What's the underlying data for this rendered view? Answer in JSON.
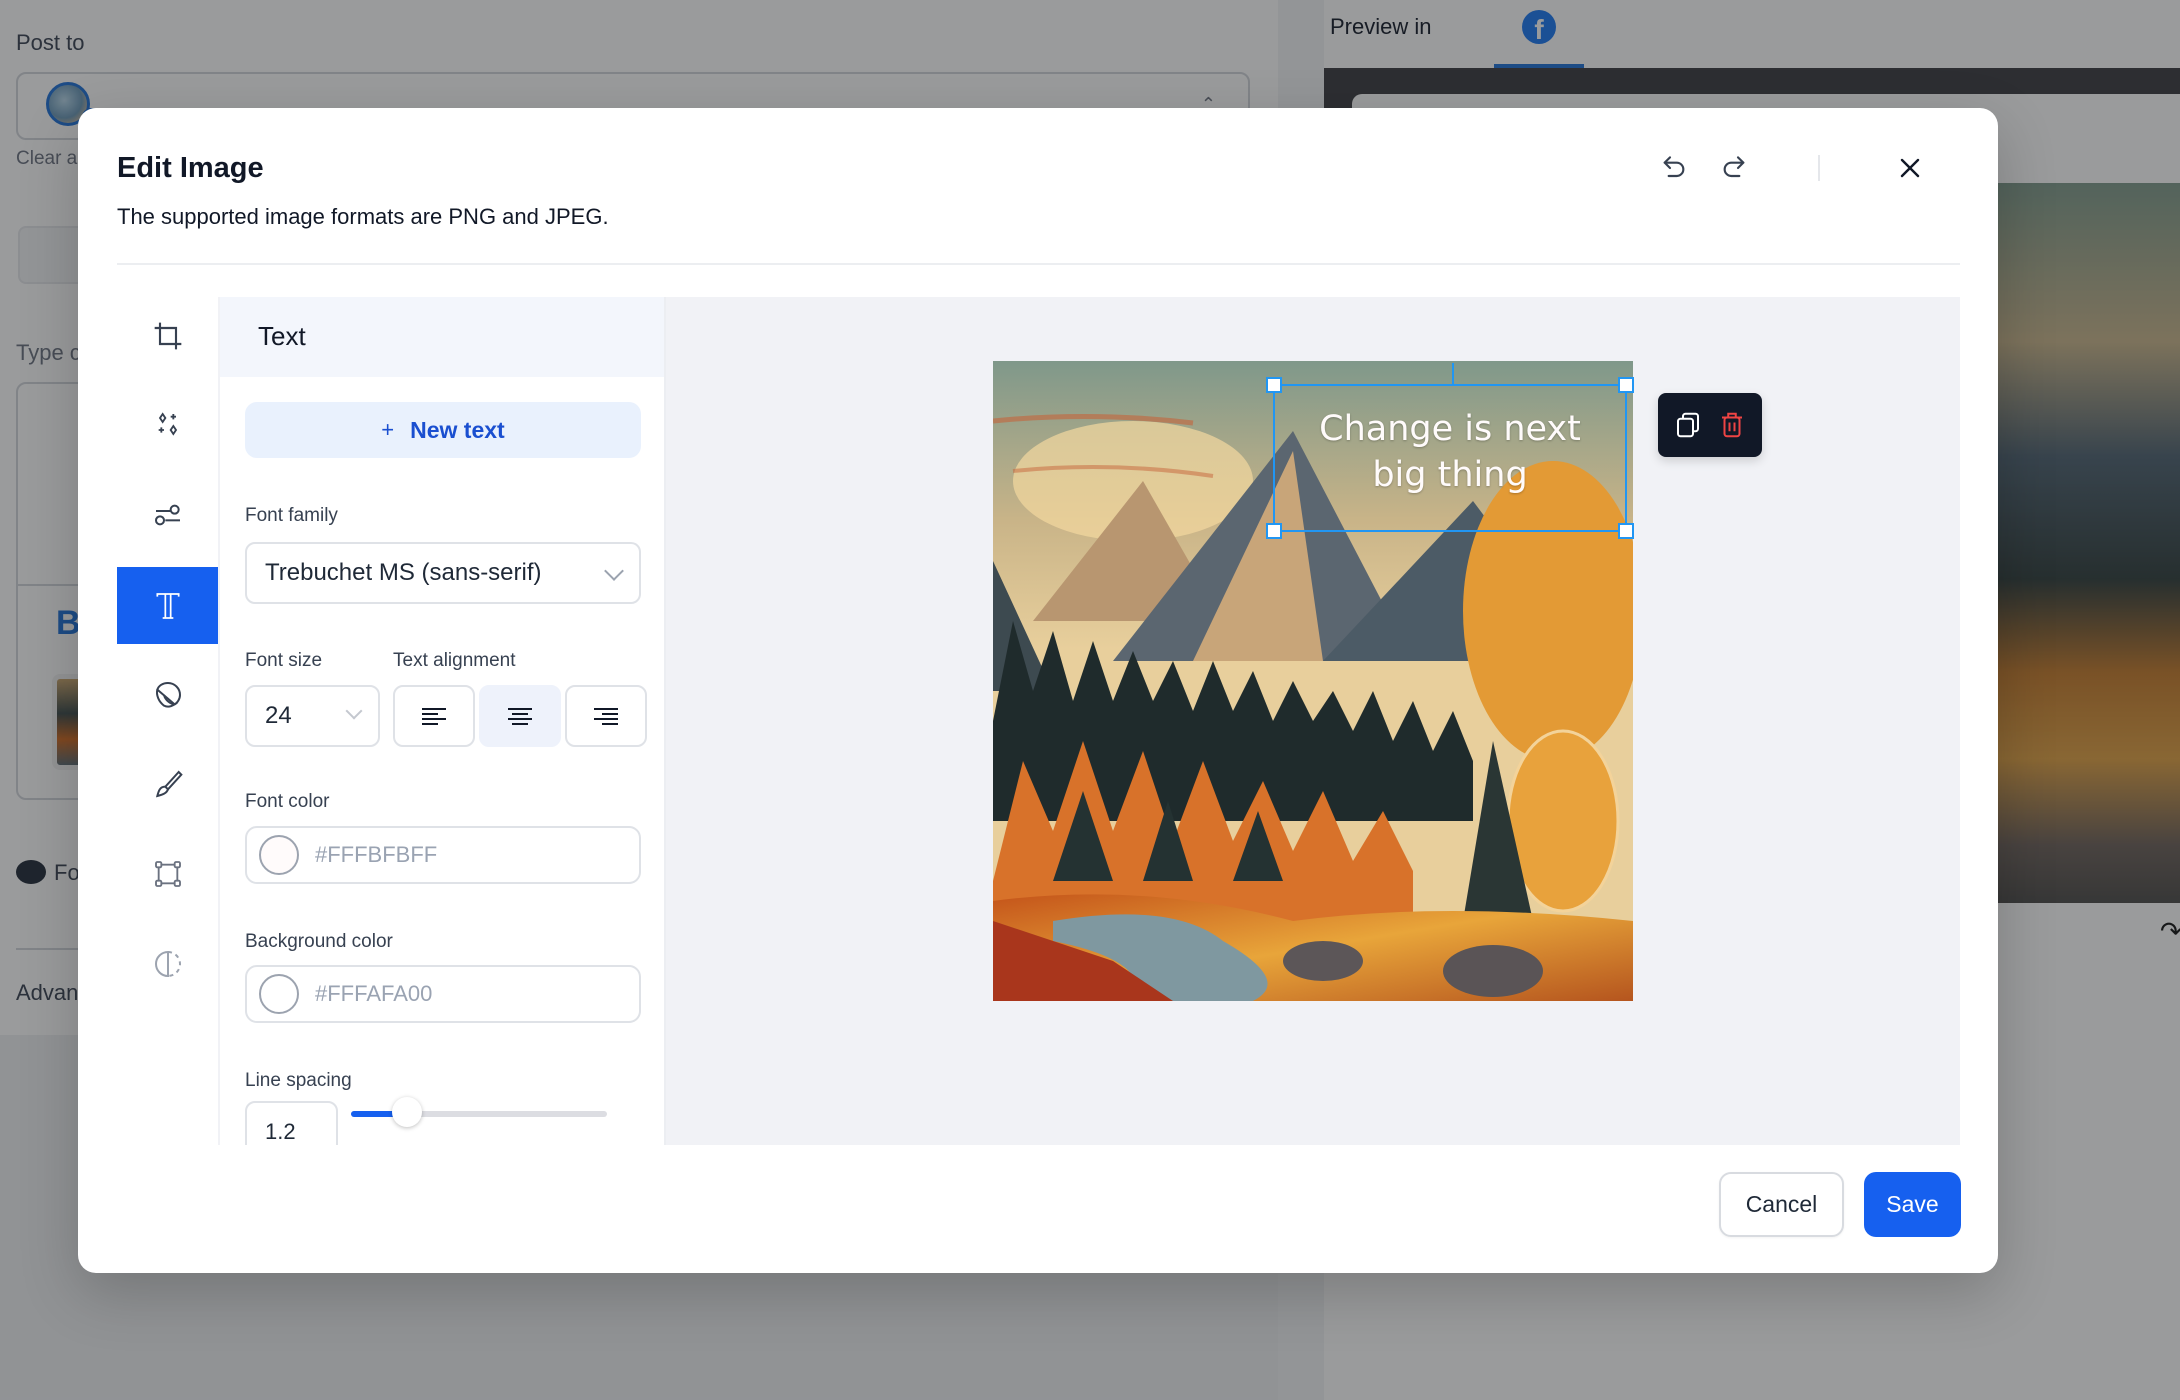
{
  "background": {
    "post_to_label": "Post to",
    "clear_label": "Clear a",
    "type_label": "Type c",
    "b_label": "B",
    "fo_label": "Fo",
    "advanced_label": "Advan",
    "preview_label": "Preview in",
    "preview_network": "facebook"
  },
  "modal": {
    "title": "Edit Image",
    "subtitle": "The supported image formats are PNG and JPEG.",
    "header_icons": [
      "undo-icon",
      "redo-icon",
      "close-icon"
    ]
  },
  "tools": [
    {
      "name": "crop",
      "icon": "crop-icon",
      "active": false
    },
    {
      "name": "filters",
      "icon": "sparkles-icon",
      "active": false
    },
    {
      "name": "adjust",
      "icon": "sliders-icon",
      "active": false
    },
    {
      "name": "text",
      "icon": "text-icon",
      "active": true
    },
    {
      "name": "sticker",
      "icon": "sticker-icon",
      "active": false
    },
    {
      "name": "draw",
      "icon": "brush-icon",
      "active": false
    },
    {
      "name": "shapes",
      "icon": "shape-icon",
      "active": false
    },
    {
      "name": "frame",
      "icon": "contrast-icon",
      "active": false
    }
  ],
  "panel": {
    "title": "Text",
    "new_text_plus": "+",
    "new_text_label": "New text",
    "font_family_label": "Font family",
    "font_family_value": "Trebuchet MS (sans-serif)",
    "font_size_label": "Font size",
    "font_size_value": "24",
    "text_alignment_label": "Text alignment",
    "alignment_options": [
      "left",
      "center",
      "right"
    ],
    "alignment_selected": "center",
    "font_color_label": "Font color",
    "font_color_value": "#FFFBFBFF",
    "font_color_swatch": "#FFFBFB",
    "background_color_label": "Background color",
    "background_color_value": "#FFFAFA00",
    "background_color_swatch": "#FFFFFF",
    "line_spacing_label": "Line spacing",
    "line_spacing_value": "1.2",
    "line_spacing_slider_fraction": 0.22
  },
  "canvas": {
    "text_line1": "Change is next",
    "text_line2": "big thing",
    "toolbar_icons": [
      "duplicate-icon",
      "trash-icon"
    ]
  },
  "footer": {
    "cancel_label": "Cancel",
    "save_label": "Save"
  },
  "colors": {
    "accent": "#1660EF",
    "selection": "#2196F3",
    "danger": "#EF4444"
  }
}
